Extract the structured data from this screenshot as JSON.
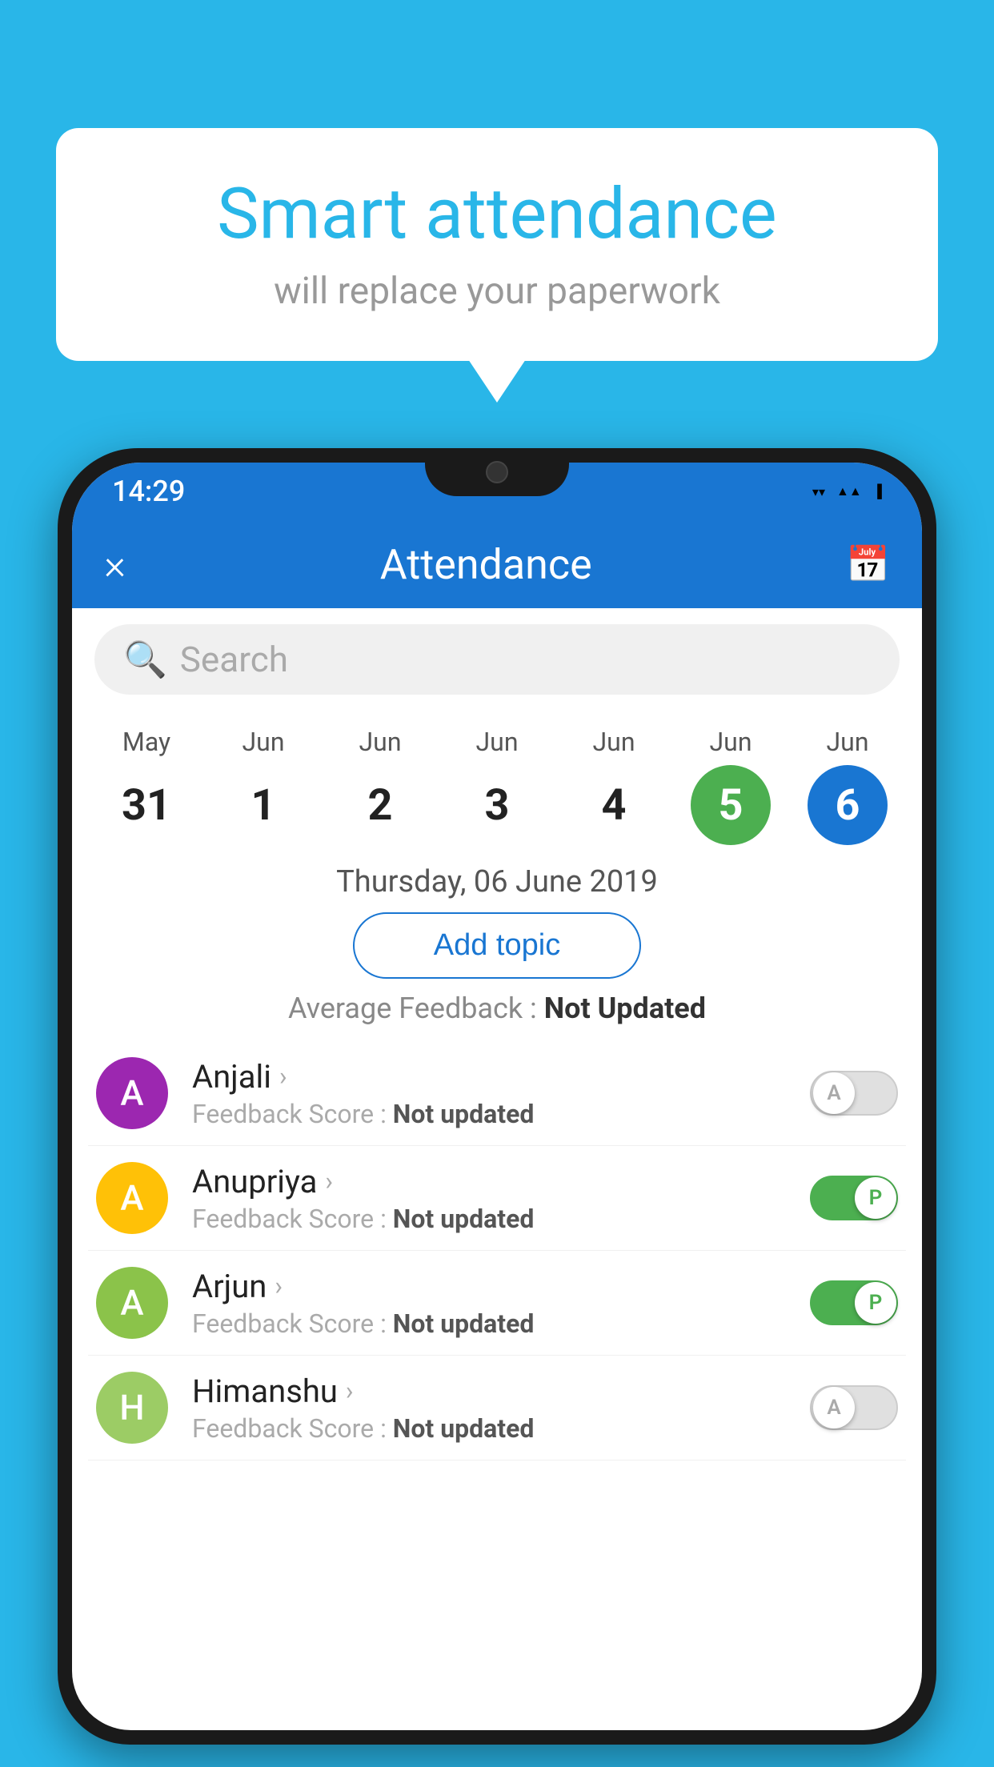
{
  "background_color": "#29B6E8",
  "bubble": {
    "title": "Smart attendance",
    "subtitle": "will replace your paperwork"
  },
  "status_bar": {
    "time": "14:29",
    "wifi": "▼",
    "signal": "▲",
    "battery": "▌"
  },
  "header": {
    "close_label": "×",
    "title": "Attendance",
    "calendar_icon": "📅"
  },
  "search": {
    "placeholder": "Search"
  },
  "calendar": {
    "days": [
      {
        "month": "May",
        "num": "31",
        "style": "normal"
      },
      {
        "month": "Jun",
        "num": "1",
        "style": "normal"
      },
      {
        "month": "Jun",
        "num": "2",
        "style": "normal"
      },
      {
        "month": "Jun",
        "num": "3",
        "style": "normal"
      },
      {
        "month": "Jun",
        "num": "4",
        "style": "normal"
      },
      {
        "month": "Jun",
        "num": "5",
        "style": "green"
      },
      {
        "month": "Jun",
        "num": "6",
        "style": "blue"
      }
    ]
  },
  "selected_date": "Thursday, 06 June 2019",
  "add_topic_label": "Add topic",
  "avg_feedback_label": "Average Feedback : ",
  "avg_feedback_value": "Not Updated",
  "students": [
    {
      "name": "Anjali",
      "avatar_letter": "A",
      "avatar_color": "purple",
      "feedback": "Not updated",
      "toggle": "off",
      "toggle_letter": "A"
    },
    {
      "name": "Anupriya",
      "avatar_letter": "A",
      "avatar_color": "yellow",
      "feedback": "Not updated",
      "toggle": "on",
      "toggle_letter": "P"
    },
    {
      "name": "Arjun",
      "avatar_letter": "A",
      "avatar_color": "light-green",
      "feedback": "Not updated",
      "toggle": "on",
      "toggle_letter": "P"
    },
    {
      "name": "Himanshu",
      "avatar_letter": "H",
      "avatar_color": "olive",
      "feedback": "Not updated",
      "toggle": "off",
      "toggle_letter": "A"
    }
  ]
}
